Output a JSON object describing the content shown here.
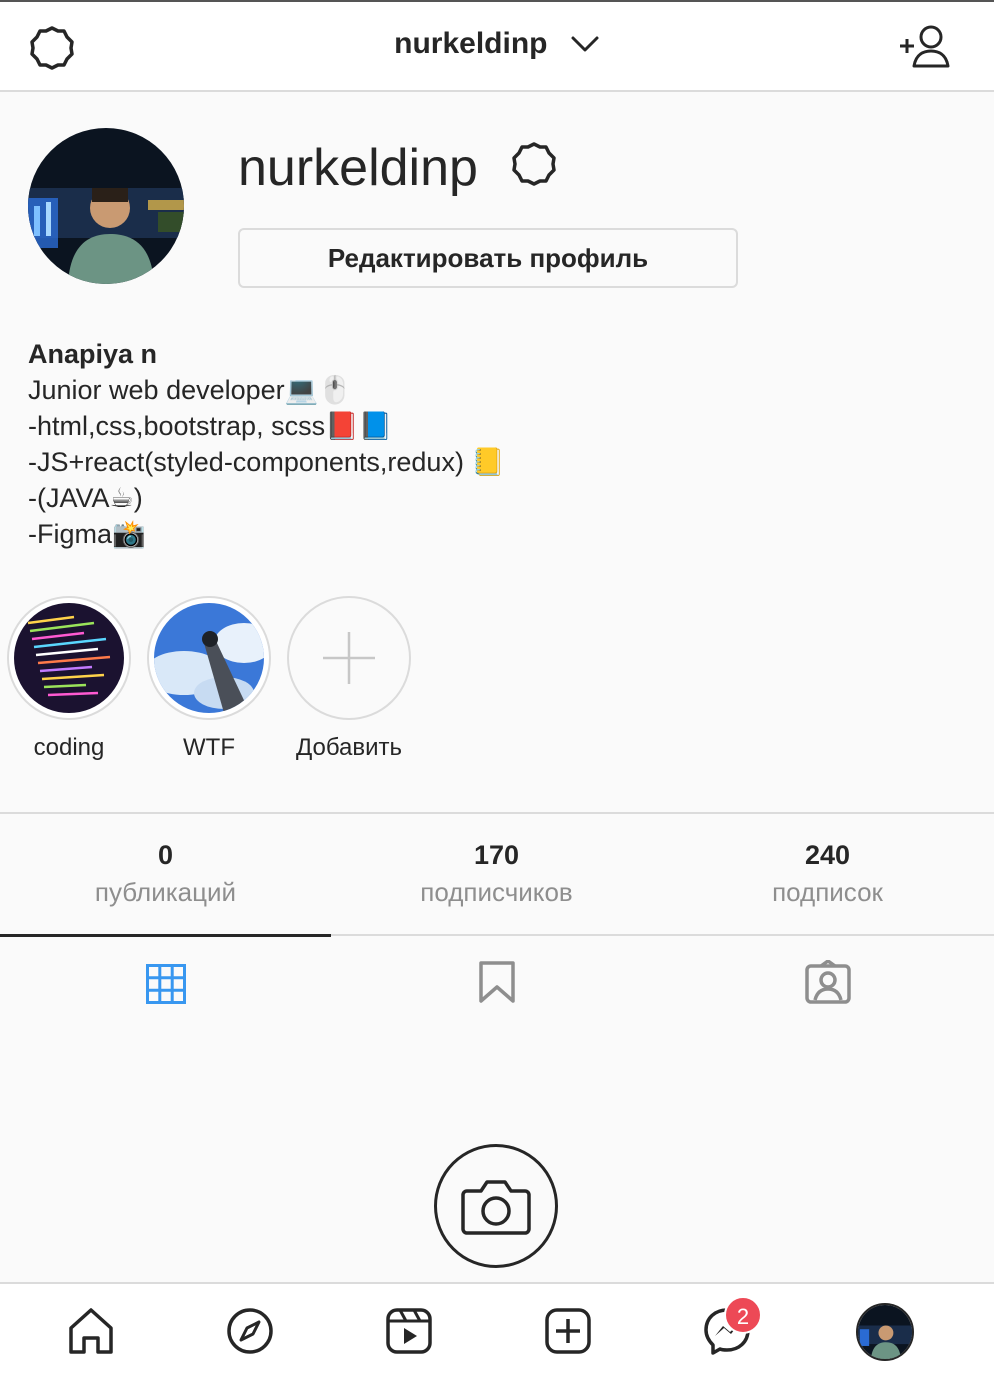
{
  "header": {
    "username": "nurkeldinp"
  },
  "profile": {
    "username": "nurkeldinp",
    "edit_button": "Редактировать профиль"
  },
  "bio": {
    "name": "Anapiya n",
    "lines": [
      "Junior web developer💻🖱️",
      "-html,css,bootstrap, scss📕📘",
      "-JS+react(styled-components,redux) 📒",
      "-(JAVA☕)",
      "-Figma📸"
    ]
  },
  "highlights": [
    {
      "label": "coding"
    },
    {
      "label": "WTF"
    },
    {
      "label": "Добавить"
    }
  ],
  "stats": [
    {
      "value": "0",
      "label": "публикаций"
    },
    {
      "value": "170",
      "label": "подписчиков"
    },
    {
      "value": "240",
      "label": "подписок"
    }
  ],
  "tabs": [
    {
      "icon": "grid-icon",
      "active": true
    },
    {
      "icon": "bookmark-icon",
      "active": false
    },
    {
      "icon": "tagged-icon",
      "active": false
    }
  ],
  "bottom_nav": {
    "messages_badge": "2"
  },
  "colors": {
    "accent_blue": "#3897f0",
    "text": "#262626",
    "muted": "#8e8e8e",
    "border": "#dbdbdb",
    "badge": "#ed4956"
  }
}
